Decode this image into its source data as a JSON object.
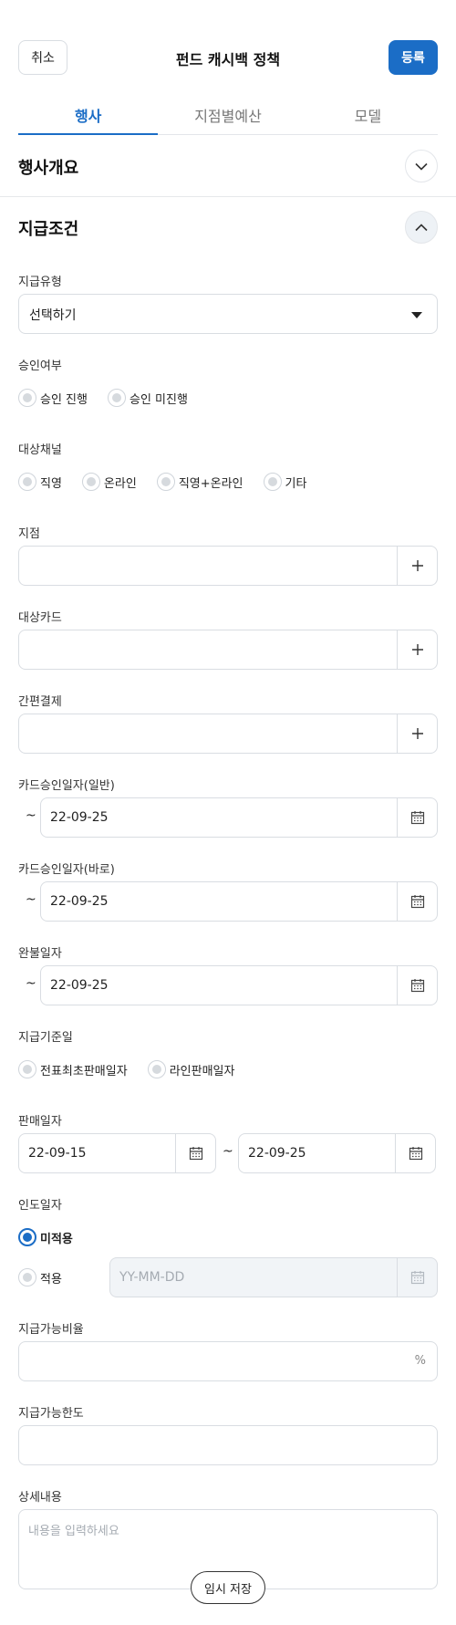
{
  "header": {
    "cancel_label": "취소",
    "title": "펀드 캐시백 정책",
    "register_label": "등록"
  },
  "tabs": [
    {
      "label": "행사",
      "active": true
    },
    {
      "label": "지점별예산",
      "active": false
    },
    {
      "label": "모델",
      "active": false
    }
  ],
  "sections": {
    "overview": {
      "title": "행사개요",
      "icon": "chevron-down-icon"
    },
    "conditions": {
      "title": "지급조건",
      "icon": "chevron-up-icon"
    }
  },
  "form": {
    "payment_type": {
      "label": "지급유형",
      "value": "선택하기"
    },
    "approval": {
      "label": "승인여부",
      "options": [
        "승인 진행",
        "승인 미진행"
      ]
    },
    "channel": {
      "label": "대상채널",
      "options": [
        "직영",
        "온라인",
        "직영+온라인",
        "기타"
      ]
    },
    "branch": {
      "label": "지점"
    },
    "card": {
      "label": "대상카드"
    },
    "easy_pay": {
      "label": "간편결제"
    },
    "card_approval_general": {
      "label": "카드승인일자(일반)",
      "tilde": "~",
      "value": "22-09-25"
    },
    "card_approval_direct": {
      "label": "카드승인일자(바로)",
      "tilde": "~",
      "value": "22-09-25"
    },
    "full_payment": {
      "label": "완불일자",
      "tilde": "~",
      "value": "22-09-25"
    },
    "payment_basis": {
      "label": "지급기준일",
      "options": [
        "전표최초판매일자",
        "라인판매일자"
      ]
    },
    "sale_date": {
      "label": "판매일자",
      "from": "22-09-15",
      "tilde": "~",
      "to": "22-09-25"
    },
    "delivery_date": {
      "label": "인도일자",
      "option_not_applied": "미적용",
      "option_applied": "적용",
      "placeholder": "YY-MM-DD"
    },
    "pay_ratio": {
      "label": "지급가능비율",
      "unit": "%"
    },
    "pay_limit": {
      "label": "지급가능한도"
    },
    "detail": {
      "label": "상세내용",
      "placeholder": "내용을 입력하세요"
    }
  },
  "footer": {
    "temp_save_label": "임시 저장"
  },
  "colors": {
    "accent": "#1b6dc6",
    "border": "#d9dde2",
    "disabled_bg": "#f1f4f7"
  }
}
